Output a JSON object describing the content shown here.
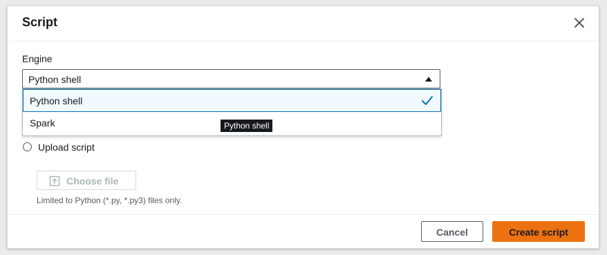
{
  "modal": {
    "title": "Script",
    "close_icon": "close-icon"
  },
  "engine": {
    "label": "Engine",
    "selected_value": "Python shell",
    "caret_icon": "caret-up-icon",
    "options": [
      {
        "label": "Python shell",
        "selected": true,
        "icon": "check-icon"
      },
      {
        "label": "Spark",
        "selected": false
      }
    ],
    "tooltip": "Python shell"
  },
  "upload": {
    "radio_label": "Upload script",
    "choose_file_label": "Choose file",
    "choose_file_icon": "upload-icon",
    "hint": "Limited to Python (*.py, *.py3) files only."
  },
  "footer": {
    "cancel_label": "Cancel",
    "create_label": "Create script"
  },
  "colors": {
    "primary_button": "#ec7211",
    "selected_option_bg": "#f1faff",
    "selected_option_border": "#0073bb",
    "check": "#0073bb",
    "tooltip_bg": "#16191f"
  }
}
